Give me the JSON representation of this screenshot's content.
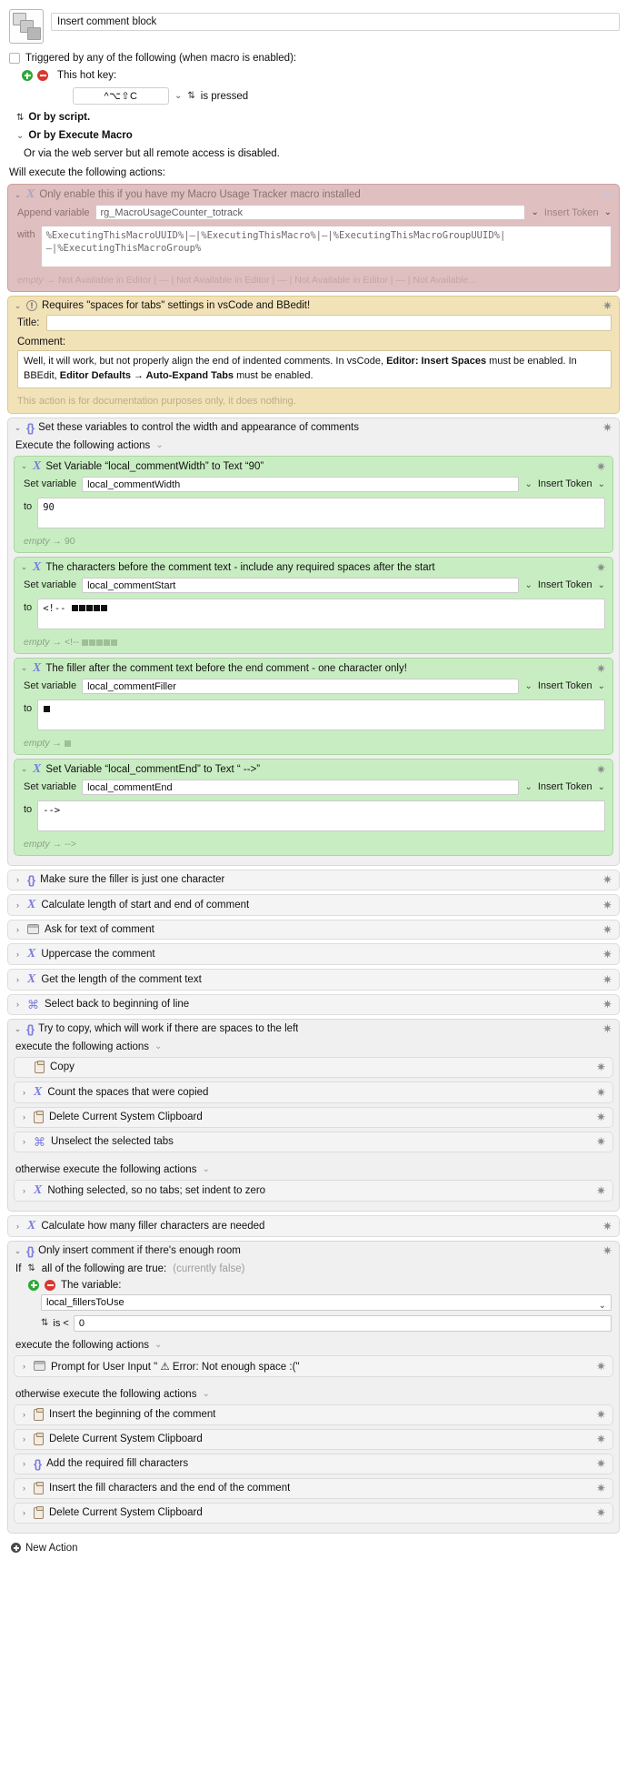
{
  "macro": {
    "name": "Insert comment block",
    "icon": "stacked-squares-icon"
  },
  "trigger": {
    "checkbox_label": "Triggered by any of the following (when macro is enabled):",
    "hotkey_label": "This hot key:",
    "hotkey_value": "^⌥⇧C",
    "is_pressed": "is pressed",
    "by_script": "Or by script.",
    "by_execute_macro": "Or by Execute Macro",
    "web_server": "Or via the web server but all remote access is disabled.",
    "will_execute": "Will execute the following actions:",
    "add_icon": "plus-circle-icon",
    "remove_icon": "minus-circle-icon"
  },
  "actions": {
    "usage_tracker": {
      "title": "Only enable this if you have my Macro Usage Tracker macro installed",
      "icon": "variable-x-icon",
      "append_label": "Append variable",
      "variable": "rg_MacroUsageCounter_totrack",
      "insert_token": "Insert Token",
      "with_label": "with",
      "with_value": "%ExecutingThisMacroUUID%|—|%ExecutingThisMacro%|—|%ExecutingThisMacroGroupUUID%|—|%ExecutingThisMacroGroup%",
      "result_prefix": "empty",
      "result": "Not Available in Editor | — | Not Available in Editor | — | Not Available in Editor | — | Not Available…"
    },
    "comment": {
      "title": "Requires \"spaces for tabs\" settings in vsCode and BBedit!",
      "icon": "exclamation-circle-icon",
      "title_label": "Title:",
      "title_value": "",
      "comment_label": "Comment:",
      "comment_body_1": "Well, it will work, but not properly align the end of indented comments. In vsCode, ",
      "comment_bold_1": "Editor: Insert Spaces",
      "comment_body_2": " must be enabled. In BBEdit, ",
      "comment_bold_2": "Editor Defaults → Auto-Expand Tabs",
      "comment_body_3": " must be enabled.",
      "note": "This action is for documentation purposes only, it does nothing."
    },
    "set_vars_group": {
      "title": "Set these variables to control the width and appearance of comments",
      "icon": "braces-icon",
      "execute_label": "Execute the following actions",
      "children": [
        {
          "title": "Set Variable “local_commentWidth” to Text “90”",
          "icon": "variable-x-icon",
          "set_label": "Set variable",
          "variable": "local_commentWidth",
          "insert_token": "Insert Token",
          "to_label": "to",
          "value": "90",
          "result_prefix": "empty",
          "result": "90"
        },
        {
          "title": "The characters before the comment text - include any required spaces after the start",
          "icon": "variable-x-icon",
          "set_label": "Set variable",
          "variable": "local_commentStart",
          "insert_token": "Insert Token",
          "to_label": "to",
          "value": "<!--",
          "value_blocks": 5,
          "result_prefix": "empty",
          "result": "<!--",
          "result_blocks": 5
        },
        {
          "title": "The filler after the comment text before the end comment - one character only!",
          "icon": "variable-x-icon",
          "set_label": "Set variable",
          "variable": "local_commentFiller",
          "insert_token": "Insert Token",
          "to_label": "to",
          "value": "",
          "value_blocks": 1,
          "result_prefix": "empty",
          "result": "",
          "result_blocks": 1
        },
        {
          "title": "Set Variable “local_commentEnd” to Text “ -->”",
          "icon": "variable-x-icon",
          "set_label": "Set variable",
          "variable": "local_commentEnd",
          "insert_token": "Insert Token",
          "to_label": "to",
          "value": "-->",
          "result_prefix": "empty",
          "result": "-->"
        }
      ]
    },
    "collapsed_list_1": [
      {
        "title": "Make sure the filler is just one character",
        "icon": "braces-icon"
      },
      {
        "title": "Calculate length of start and end of comment",
        "icon": "variable-x-icon"
      },
      {
        "title": "Ask for text of comment",
        "icon": "window-icon"
      },
      {
        "title": "Uppercase the comment",
        "icon": "variable-x-icon"
      },
      {
        "title": "Get the length of the comment text",
        "icon": "variable-x-icon"
      },
      {
        "title": "Select back to beginning of line",
        "icon": "command-key-icon"
      }
    ],
    "try_copy_group": {
      "title": "Try to copy, which will work if there are spaces to the left",
      "icon": "braces-icon",
      "execute_label": "execute the following actions",
      "children": [
        {
          "title": "Copy",
          "icon": "clipboard-icon",
          "no_chevron": true
        },
        {
          "title": "Count the spaces that were copied",
          "icon": "variable-x-icon"
        },
        {
          "title": "Delete Current System Clipboard",
          "icon": "clipboard-icon"
        },
        {
          "title": "Unselect the selected tabs",
          "icon": "command-key-icon"
        }
      ],
      "otherwise_label": "otherwise execute the following actions",
      "otherwise_children": [
        {
          "title": "Nothing selected, so no tabs; set indent to zero",
          "icon": "variable-x-icon"
        }
      ]
    },
    "calc_fillers": {
      "title": "Calculate how many filler characters are needed",
      "icon": "variable-x-icon"
    },
    "enough_room_group": {
      "title": "Only insert comment if there's enough room",
      "icon": "braces-icon",
      "if_label": "If",
      "all_of_label": "all of the following are true:",
      "currently": "(currently false)",
      "the_variable_label": "The variable:",
      "variable": "local_fillersToUse",
      "is_label": "is <",
      "number": "0",
      "execute_label": "execute the following actions",
      "children": [
        {
          "title": "Prompt for User Input \" ⚠ Error: Not enough space :(\"",
          "icon": "window-icon",
          "warn": true
        }
      ],
      "otherwise_label": "otherwise execute the following actions",
      "otherwise_children": [
        {
          "title": "Insert the beginning of the comment",
          "icon": "clipboard-icon"
        },
        {
          "title": "Delete Current System Clipboard",
          "icon": "clipboard-icon"
        },
        {
          "title": "Add the required fill characters",
          "icon": "braces-icon"
        },
        {
          "title": "Insert the fill characters and the end of the comment",
          "icon": "clipboard-icon"
        },
        {
          "title": "Delete Current System Clipboard",
          "icon": "clipboard-icon"
        }
      ]
    }
  },
  "footer": {
    "new_action": "New Action",
    "icon": "plus-circle-icon"
  },
  "glyphs": {
    "chevron_down": "⌄",
    "chevron_right": "›",
    "stepper": "⇅",
    "gear": "✷",
    "arrow": "→"
  }
}
